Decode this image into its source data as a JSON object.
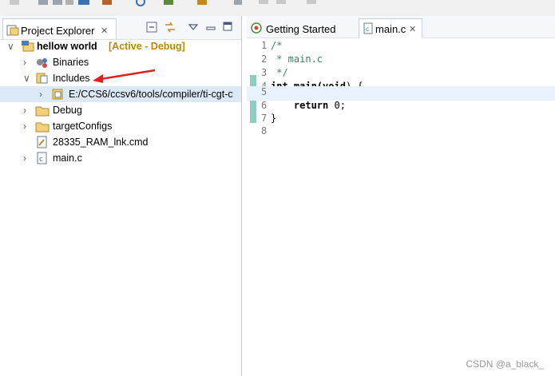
{
  "project_explorer": {
    "tab_title": "Project Explorer",
    "tab_close": "✕"
  },
  "tree": {
    "project_name": "hellow world",
    "project_status": "[Active - Debug]",
    "binaries": "Binaries",
    "includes": "Includes",
    "include_path": "E:/CCS6/ccsv6/tools/compiler/ti-cgt-c",
    "debug": "Debug",
    "target_configs": "targetConfigs",
    "linker_cmd": "28335_RAM_lnk.cmd",
    "main_c": "main.c"
  },
  "editor": {
    "tabs": [
      {
        "label": "Getting Started"
      },
      {
        "label": "main.c",
        "close": "✕"
      }
    ],
    "lines": [
      {
        "num": "1",
        "text": "/*"
      },
      {
        "num": "2",
        "text": " * main.c"
      },
      {
        "num": "3",
        "text": " */"
      },
      {
        "num": "4",
        "kw1": "int",
        "fn": " main(",
        "kw2": "void",
        "rest": ") {"
      },
      {
        "num": "5",
        "text": ""
      },
      {
        "num": "6",
        "kw": "    return",
        "rest": " 0;"
      },
      {
        "num": "7",
        "text": "}"
      },
      {
        "num": "8",
        "text": ""
      }
    ]
  },
  "watermark": "CSDN @a_black_",
  "colors": {
    "comment": "#3f7f5f",
    "selection": "#dbe9f7",
    "arrow": "#e02020",
    "status": "#b8860b"
  }
}
